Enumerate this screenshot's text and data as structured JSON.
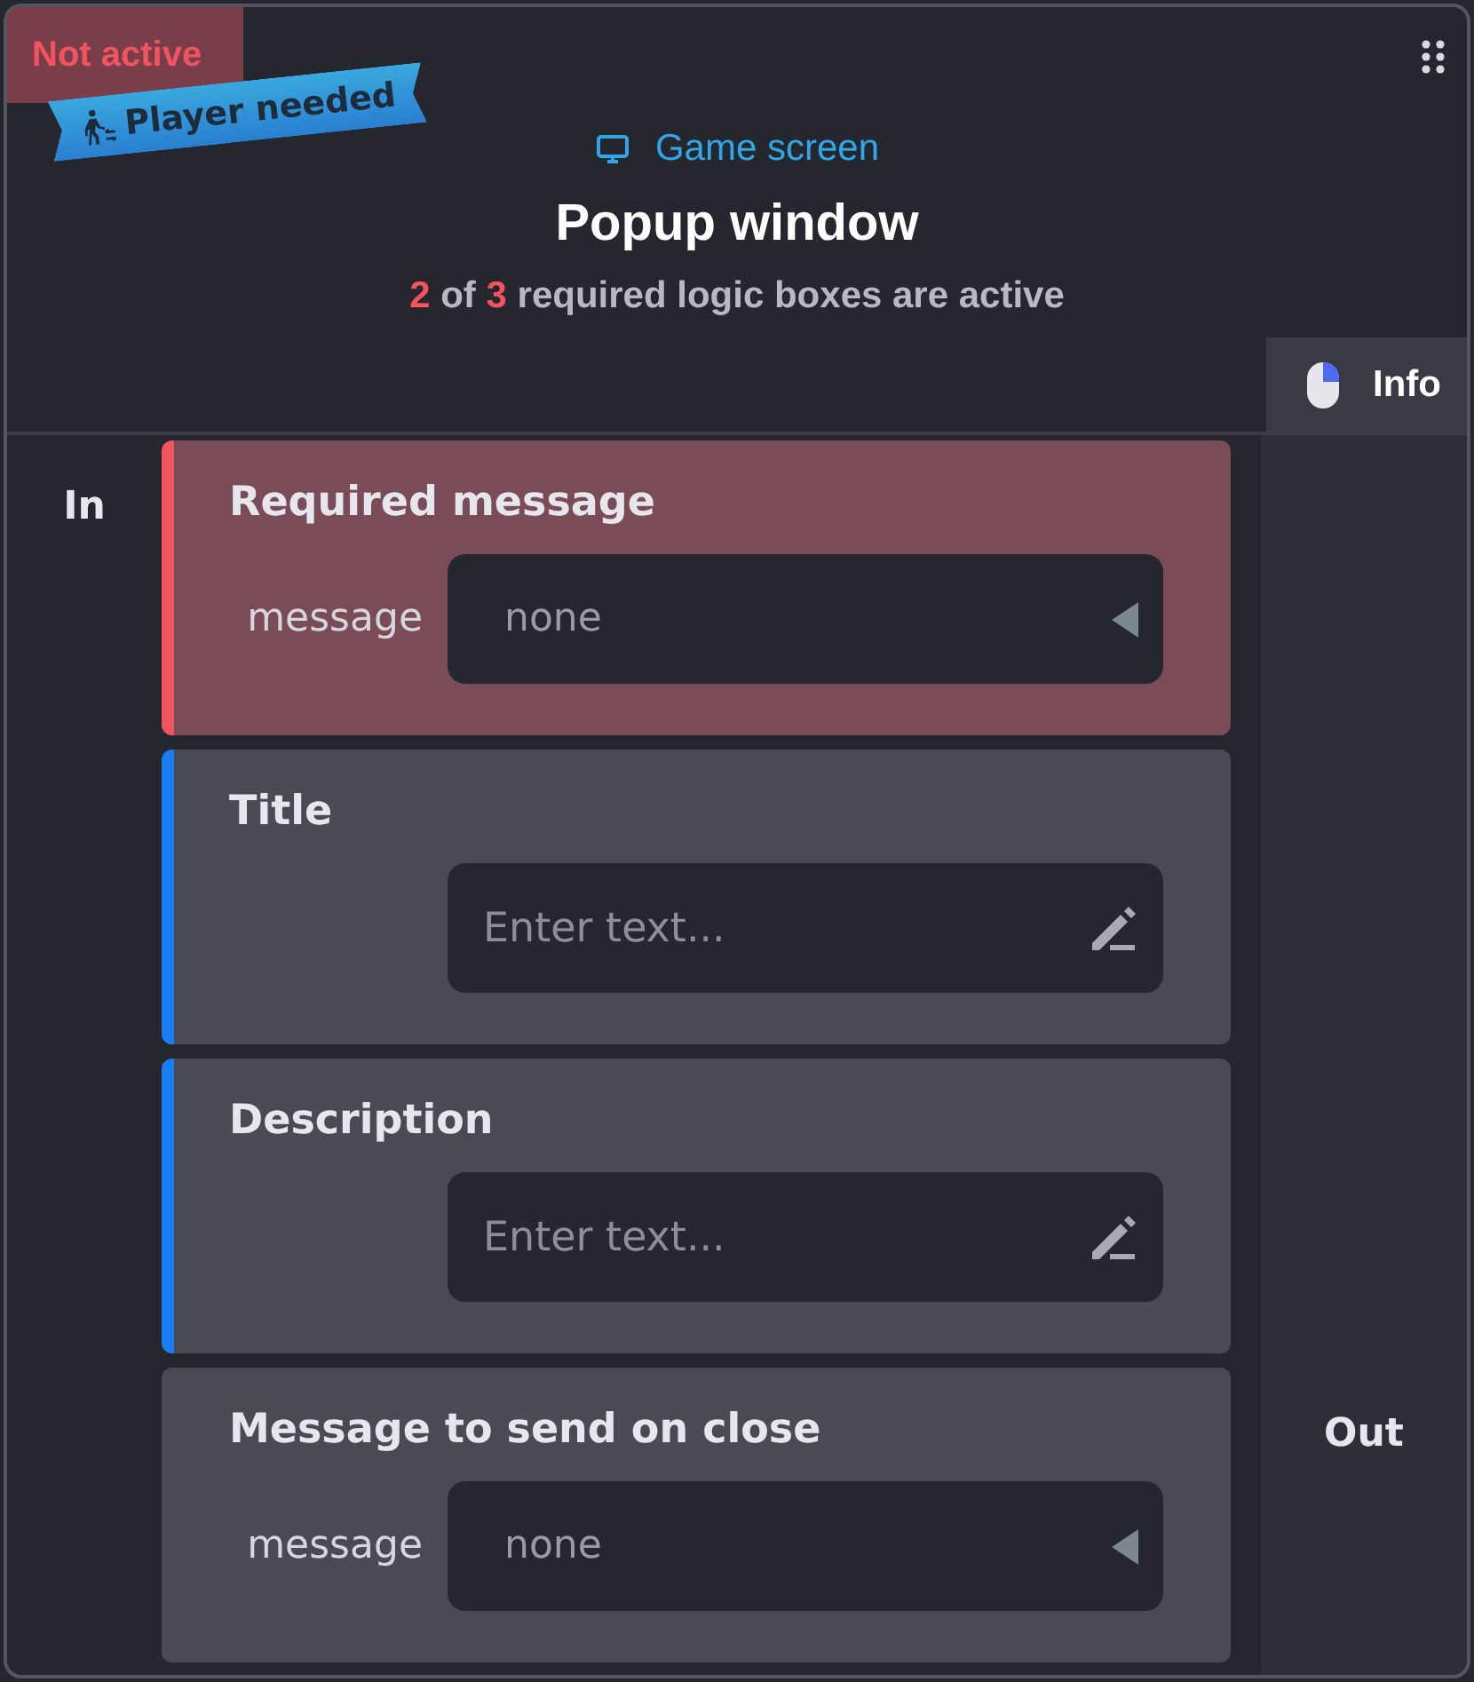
{
  "status_badge": "Not active",
  "ribbon": "Player needed",
  "category": "Game screen",
  "title": "Popup window",
  "summary": {
    "active_count": "2",
    "middle": "of",
    "required_count": "3",
    "rest": "required logic boxes are active"
  },
  "side_tab": {
    "label": "Info",
    "selected": true
  },
  "inputs_label": "In",
  "outputs_label": "Out",
  "boxes": [
    {
      "title": "Required message",
      "required": true,
      "active": false,
      "field": {
        "kind": "dropdown",
        "label": "message",
        "value": "none"
      }
    },
    {
      "title": "Title",
      "required": true,
      "active": true,
      "field": {
        "kind": "text",
        "placeholder": "Enter text..."
      }
    },
    {
      "title": "Description",
      "required": true,
      "active": true,
      "field": {
        "kind": "text",
        "placeholder": "Enter text..."
      }
    },
    {
      "title": "Message to send on close",
      "required": false,
      "field": {
        "kind": "dropdown",
        "label": "message",
        "value": "none"
      }
    }
  ]
}
